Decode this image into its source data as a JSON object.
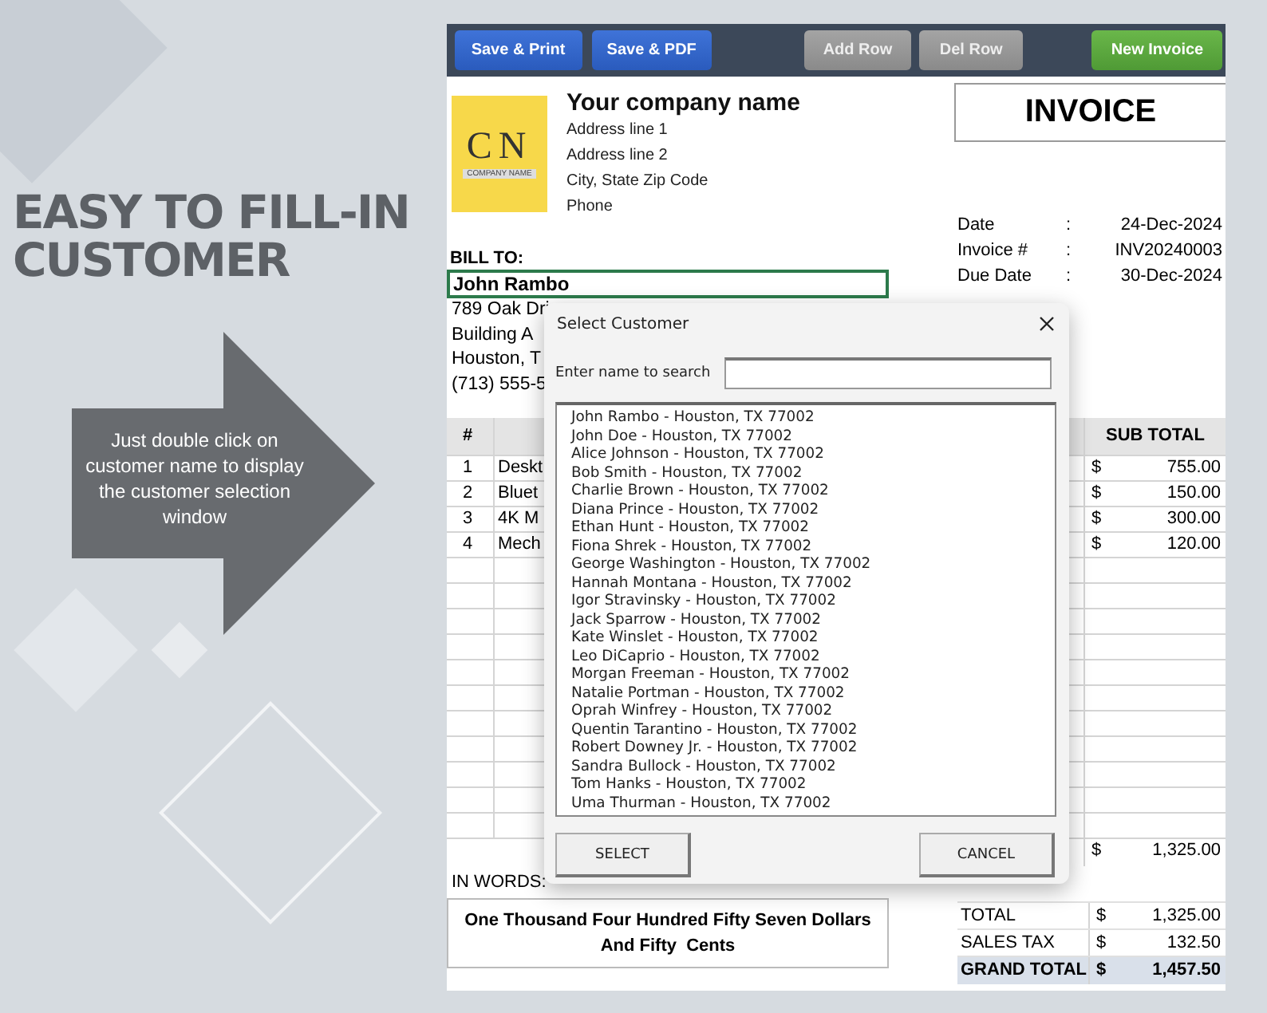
{
  "promo": {
    "headline": [
      "EASY TO FILL-IN",
      "CUSTOMER"
    ],
    "callout": "Just double click on customer name to display the customer selection window"
  },
  "toolbar": {
    "buttons": [
      {
        "label": "Save & Print",
        "kind": "primary"
      },
      {
        "label": "Save & PDF",
        "kind": "primary"
      },
      {
        "label": "Add Row",
        "kind": "neutral"
      },
      {
        "label": "Del Row",
        "kind": "neutral"
      },
      {
        "label": "New Invoice",
        "kind": "success"
      }
    ]
  },
  "company": {
    "logo": {
      "initials": "CN",
      "tagline": "COMPANY NAME"
    },
    "name": "Your company name",
    "address_lines": [
      "Address line 1",
      "Address line 2",
      "City, State Zip Code",
      "Phone"
    ]
  },
  "invoice": {
    "title": "INVOICE",
    "fields": [
      {
        "label": "Date",
        "separator": ":",
        "value": "24-Dec-2024"
      },
      {
        "label": "Invoice #",
        "separator": ":",
        "value": "INV20240003"
      },
      {
        "label": "Due Date",
        "separator": ":",
        "value": "30-Dec-2024"
      }
    ]
  },
  "bill_to": {
    "label": "BILL TO:",
    "customer_name": "John Rambo",
    "customer_selected": true,
    "lines": [
      "789 Oak Dri",
      "Building A",
      "Houston, T",
      "(713) 555-5"
    ]
  },
  "items_table": {
    "header": {
      "number": "#",
      "sub_total": "SUB TOTAL"
    },
    "rows": [
      {
        "number": "1",
        "description": "Deskt",
        "currency": "$",
        "sub_total": "755.00"
      },
      {
        "number": "2",
        "description": "Bluet",
        "currency": "$",
        "sub_total": "150.00"
      },
      {
        "number": "3",
        "description": "4K M",
        "currency": "$",
        "sub_total": "300.00"
      },
      {
        "number": "4",
        "description": "Mech",
        "currency": "$",
        "sub_total": "120.00"
      }
    ],
    "subtotal": {
      "currency": "$",
      "amount": "1,325.00"
    }
  },
  "in_words": {
    "label": "IN WORDS:",
    "text": "One Thousand Four Hundred Fifty Seven Dollars And Fifty  Cents"
  },
  "totals": [
    {
      "label": "TOTAL",
      "currency": "$",
      "amount": "1,325.00",
      "kind": "normal"
    },
    {
      "label": "SALES TAX",
      "currency": "$",
      "amount": "132.50",
      "kind": "normal"
    },
    {
      "label": "GRAND TOTAL",
      "currency": "$",
      "amount": "1,457.50",
      "kind": "grand"
    }
  ],
  "dialog": {
    "title": "Select Customer",
    "search_label": "Enter name to search",
    "customers": [
      "John Rambo - Houston, TX 77002",
      "John Doe - Houston, TX 77002",
      "Alice Johnson - Houston, TX 77002",
      "Bob Smith - Houston, TX 77002",
      "Charlie Brown - Houston, TX 77002",
      "Diana Prince - Houston, TX 77002",
      "Ethan Hunt - Houston, TX 77002",
      "Fiona Shrek - Houston, TX 77002",
      "George Washington - Houston, TX 77002",
      "Hannah Montana - Houston, TX 77002",
      "Igor Stravinsky - Houston, TX 77002",
      "Jack Sparrow - Houston, TX 77002",
      "Kate Winslet - Houston, TX 77002",
      "Leo DiCaprio - Houston, TX 77002",
      "Morgan Freeman - Houston, TX 77002",
      "Natalie Portman - Houston, TX 77002",
      "Oprah Winfrey - Houston, TX 77002",
      "Quentin Tarantino - Houston, TX 77002",
      "Robert Downey Jr. - Houston, TX 77002",
      "Sandra Bullock - Houston, TX 77002",
      "Tom Hanks - Houston, TX 77002",
      "Uma Thurman - Houston, TX 77002"
    ],
    "buttons": [
      "SELECT",
      "CANCEL"
    ]
  }
}
